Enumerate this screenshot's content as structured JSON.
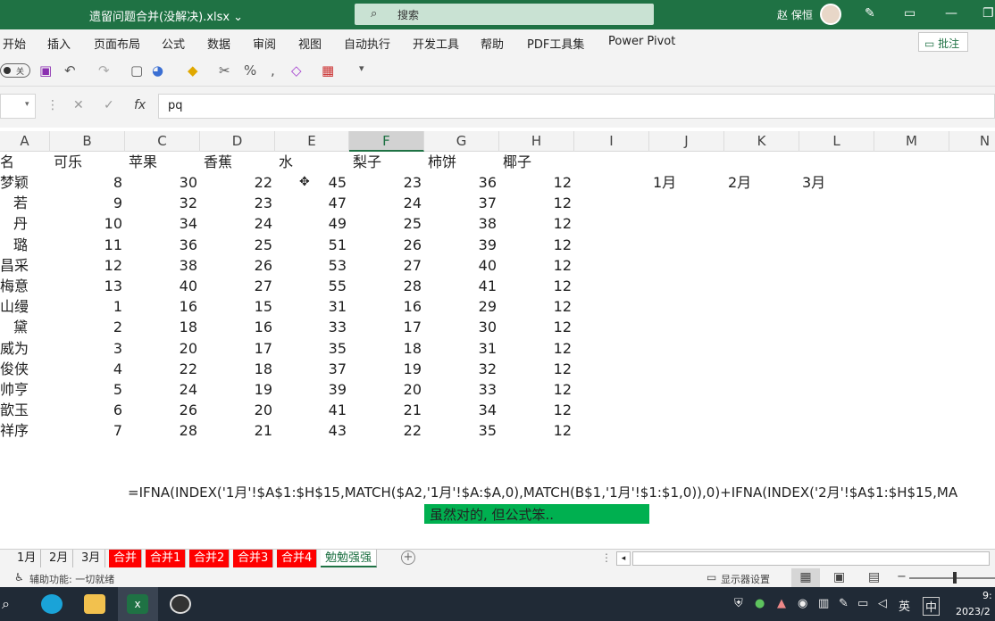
{
  "titlebar": {
    "filename": "遗留问题合并(没解决).xlsx ⌄",
    "search_placeholder": "搜索",
    "user": "赵 保恒"
  },
  "menu": [
    "开始",
    "插入",
    "页面布局",
    "公式",
    "数据",
    "审阅",
    "视图",
    "自动执行",
    "开发工具",
    "帮助",
    "PDF工具集",
    "Power Pivot"
  ],
  "comment_label": "批注",
  "toggle_label": "关",
  "formula_bar": {
    "fx": "fx",
    "content": "pq"
  },
  "columns": [
    "A",
    "B",
    "C",
    "D",
    "E",
    "F",
    "G",
    "H",
    "I",
    "J",
    "K",
    "L",
    "M",
    "N"
  ],
  "headers": [
    "名",
    "可乐",
    "苹果",
    "香蕉",
    "水",
    "梨子",
    "柿饼",
    "椰子"
  ],
  "months": [
    "1月",
    "2月",
    "3月"
  ],
  "rows": [
    [
      "梦颖",
      "8",
      "30",
      "22",
      "45",
      "23",
      "36",
      "12"
    ],
    [
      "若",
      "9",
      "32",
      "23",
      "47",
      "24",
      "37",
      "12"
    ],
    [
      "丹",
      "10",
      "34",
      "24",
      "49",
      "25",
      "38",
      "12"
    ],
    [
      "璐",
      "11",
      "36",
      "25",
      "51",
      "26",
      "39",
      "12"
    ],
    [
      "昌采",
      "12",
      "38",
      "26",
      "53",
      "27",
      "40",
      "12"
    ],
    [
      "梅意",
      "13",
      "40",
      "27",
      "55",
      "28",
      "41",
      "12"
    ],
    [
      "山缦",
      "1",
      "16",
      "15",
      "31",
      "16",
      "29",
      "12"
    ],
    [
      "黛",
      "2",
      "18",
      "16",
      "33",
      "17",
      "30",
      "12"
    ],
    [
      "威为",
      "3",
      "20",
      "17",
      "35",
      "18",
      "31",
      "12"
    ],
    [
      "俊侠",
      "4",
      "22",
      "18",
      "37",
      "19",
      "32",
      "12"
    ],
    [
      "帅亨",
      "5",
      "24",
      "19",
      "39",
      "20",
      "33",
      "12"
    ],
    [
      "歆玉",
      "6",
      "26",
      "20",
      "41",
      "21",
      "34",
      "12"
    ],
    [
      "祥序",
      "7",
      "28",
      "21",
      "43",
      "22",
      "35",
      "12"
    ]
  ],
  "formula_text": "=IFNA(INDEX('1月'!$A$1:$H$15,MATCH($A2,'1月'!$A:$A,0),MATCH(B$1,'1月'!$1:$1,0)),0)+IFNA(INDEX('2月'!$A$1:$H$15,MA",
  "note": "虽然对的, 但公式笨..",
  "sheet_tabs": [
    {
      "label": "1月",
      "style": "normal"
    },
    {
      "label": "2月",
      "style": "normal"
    },
    {
      "label": "3月",
      "style": "normal"
    },
    {
      "label": "合并",
      "style": "red"
    },
    {
      "label": "合并1",
      "style": "red"
    },
    {
      "label": "合并2",
      "style": "red"
    },
    {
      "label": "合并3",
      "style": "red"
    },
    {
      "label": "合并4",
      "style": "red"
    },
    {
      "label": "勉勉强强",
      "style": "active"
    }
  ],
  "status": {
    "accessibility": "辅助功能: 一切就绪",
    "display": "显示器设置"
  },
  "taskbar": {
    "lang": "英",
    "ime": "中",
    "time": "9:",
    "date": "2023/2"
  }
}
